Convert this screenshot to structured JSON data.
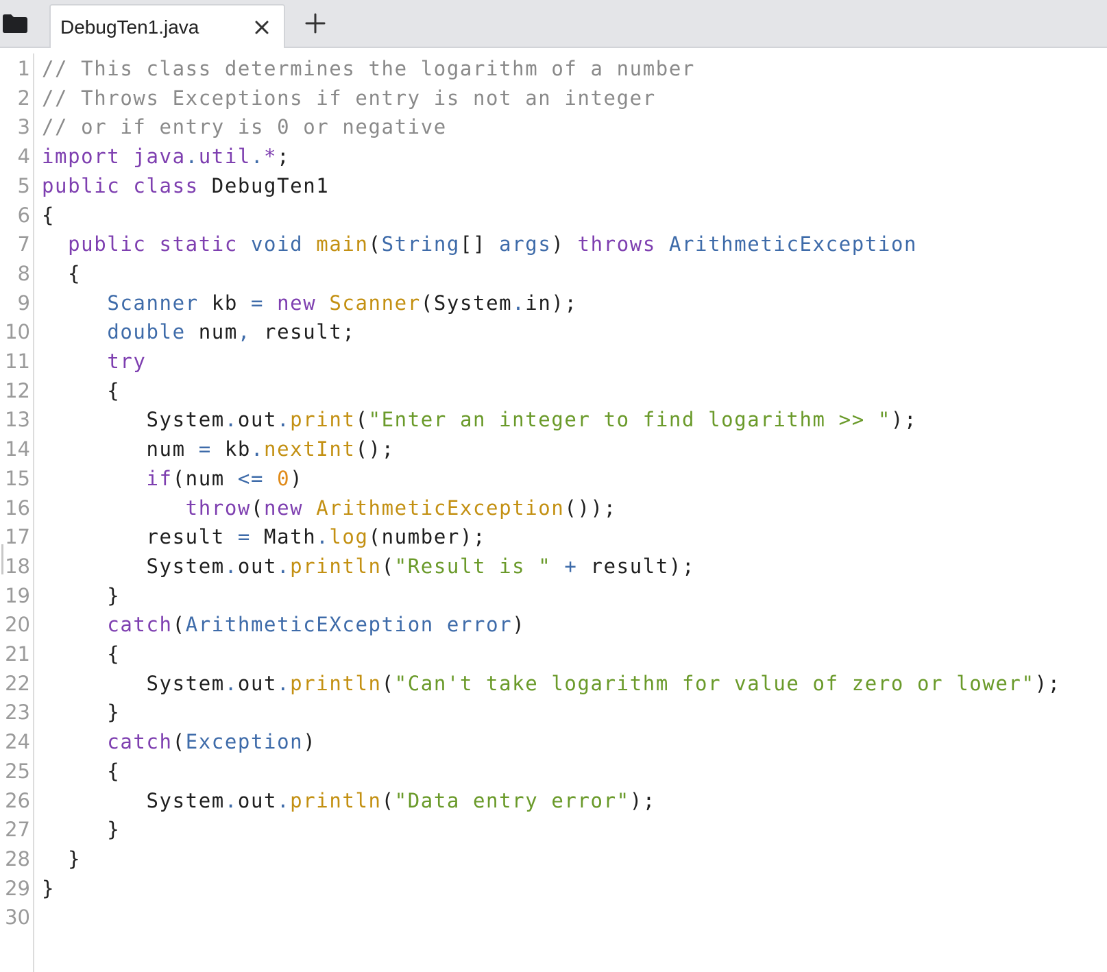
{
  "tab": {
    "title": "DebugTen1.java"
  },
  "icons": {
    "folder": "folder-icon",
    "close": "close-icon",
    "add": "plus-icon"
  },
  "colors": {
    "comment": "#8a8a8a",
    "keyword": "#7e3fb0",
    "type": "#3e6ba9",
    "method": "#c39012",
    "string": "#6a9a2a",
    "number": "#e08a18",
    "plain": "#1f1f1f",
    "line_number": "#9a9a9a",
    "tab_bar": "#e4e5e8"
  },
  "editor": {
    "lines": [
      {
        "num": "1",
        "tokens": [
          {
            "t": "// This class determines the logarithm of a number",
            "c": "comment"
          }
        ]
      },
      {
        "num": "2",
        "tokens": [
          {
            "t": "// Throws Exceptions if entry is not an integer",
            "c": "comment"
          }
        ]
      },
      {
        "num": "3",
        "tokens": [
          {
            "t": "// or if entry is 0 or negative",
            "c": "comment"
          }
        ]
      },
      {
        "num": "4",
        "tokens": [
          {
            "t": "import",
            "c": "keyword"
          },
          {
            "t": " ",
            "c": "plain"
          },
          {
            "t": "java",
            "c": "keyword"
          },
          {
            "t": ".",
            "c": "punct"
          },
          {
            "t": "util",
            "c": "keyword"
          },
          {
            "t": ".",
            "c": "punct"
          },
          {
            "t": "*",
            "c": "keyword"
          },
          {
            "t": ";",
            "c": "plain"
          }
        ]
      },
      {
        "num": "5",
        "tokens": [
          {
            "t": "public",
            "c": "keyword"
          },
          {
            "t": " ",
            "c": "plain"
          },
          {
            "t": "class",
            "c": "keyword"
          },
          {
            "t": " DebugTen1",
            "c": "plain"
          }
        ]
      },
      {
        "num": "6",
        "tokens": [
          {
            "t": "{",
            "c": "plain"
          }
        ]
      },
      {
        "num": "7",
        "tokens": [
          {
            "t": "  ",
            "c": "plain"
          },
          {
            "t": "public",
            "c": "keyword"
          },
          {
            "t": " ",
            "c": "plain"
          },
          {
            "t": "static",
            "c": "keyword"
          },
          {
            "t": " ",
            "c": "plain"
          },
          {
            "t": "void",
            "c": "type"
          },
          {
            "t": " ",
            "c": "plain"
          },
          {
            "t": "main",
            "c": "method"
          },
          {
            "t": "(",
            "c": "plain"
          },
          {
            "t": "String",
            "c": "type"
          },
          {
            "t": "[] ",
            "c": "plain"
          },
          {
            "t": "args",
            "c": "type"
          },
          {
            "t": ") ",
            "c": "plain"
          },
          {
            "t": "throws",
            "c": "keyword"
          },
          {
            "t": " ",
            "c": "plain"
          },
          {
            "t": "ArithmeticException",
            "c": "type"
          }
        ]
      },
      {
        "num": "8",
        "tokens": [
          {
            "t": "  {",
            "c": "plain"
          }
        ]
      },
      {
        "num": "9",
        "tokens": [
          {
            "t": "     ",
            "c": "plain"
          },
          {
            "t": "Scanner",
            "c": "type"
          },
          {
            "t": " kb ",
            "c": "plain"
          },
          {
            "t": "=",
            "c": "punct"
          },
          {
            "t": " ",
            "c": "plain"
          },
          {
            "t": "new",
            "c": "keyword"
          },
          {
            "t": " ",
            "c": "plain"
          },
          {
            "t": "Scanner",
            "c": "method"
          },
          {
            "t": "(System",
            "c": "plain"
          },
          {
            "t": ".",
            "c": "punct"
          },
          {
            "t": "in);",
            "c": "plain"
          }
        ]
      },
      {
        "num": "10",
        "tokens": [
          {
            "t": "     ",
            "c": "plain"
          },
          {
            "t": "double",
            "c": "type"
          },
          {
            "t": " num",
            "c": "plain"
          },
          {
            "t": ",",
            "c": "punct"
          },
          {
            "t": " result;",
            "c": "plain"
          }
        ]
      },
      {
        "num": "11",
        "tokens": [
          {
            "t": "     ",
            "c": "plain"
          },
          {
            "t": "try",
            "c": "keyword"
          }
        ]
      },
      {
        "num": "12",
        "tokens": [
          {
            "t": "     {",
            "c": "plain"
          }
        ]
      },
      {
        "num": "13",
        "tokens": [
          {
            "t": "        System",
            "c": "plain"
          },
          {
            "t": ".",
            "c": "punct"
          },
          {
            "t": "out",
            "c": "plain"
          },
          {
            "t": ".",
            "c": "punct"
          },
          {
            "t": "print",
            "c": "method"
          },
          {
            "t": "(",
            "c": "plain"
          },
          {
            "t": "\"Enter an integer to find logarithm >> \"",
            "c": "string"
          },
          {
            "t": ");",
            "c": "plain"
          }
        ]
      },
      {
        "num": "14",
        "tokens": [
          {
            "t": "        num ",
            "c": "plain"
          },
          {
            "t": "=",
            "c": "punct"
          },
          {
            "t": " kb",
            "c": "plain"
          },
          {
            "t": ".",
            "c": "punct"
          },
          {
            "t": "nextInt",
            "c": "method"
          },
          {
            "t": "();",
            "c": "plain"
          }
        ]
      },
      {
        "num": "15",
        "tokens": [
          {
            "t": "        ",
            "c": "plain"
          },
          {
            "t": "if",
            "c": "keyword"
          },
          {
            "t": "(num ",
            "c": "plain"
          },
          {
            "t": "<=",
            "c": "punct"
          },
          {
            "t": " ",
            "c": "plain"
          },
          {
            "t": "0",
            "c": "number"
          },
          {
            "t": ")",
            "c": "plain"
          }
        ]
      },
      {
        "num": "16",
        "tokens": [
          {
            "t": "           ",
            "c": "plain"
          },
          {
            "t": "throw",
            "c": "keyword"
          },
          {
            "t": "(",
            "c": "plain"
          },
          {
            "t": "new",
            "c": "keyword"
          },
          {
            "t": " ",
            "c": "plain"
          },
          {
            "t": "ArithmeticException",
            "c": "method"
          },
          {
            "t": "());",
            "c": "plain"
          }
        ]
      },
      {
        "num": "17",
        "tokens": [
          {
            "t": "        result ",
            "c": "plain"
          },
          {
            "t": "=",
            "c": "punct"
          },
          {
            "t": " Math",
            "c": "plain"
          },
          {
            "t": ".",
            "c": "punct"
          },
          {
            "t": "log",
            "c": "method"
          },
          {
            "t": "(number);",
            "c": "plain"
          }
        ]
      },
      {
        "num": "18",
        "tokens": [
          {
            "t": "        System",
            "c": "plain"
          },
          {
            "t": ".",
            "c": "punct"
          },
          {
            "t": "out",
            "c": "plain"
          },
          {
            "t": ".",
            "c": "punct"
          },
          {
            "t": "println",
            "c": "method"
          },
          {
            "t": "(",
            "c": "plain"
          },
          {
            "t": "\"Result is \"",
            "c": "string"
          },
          {
            "t": " ",
            "c": "plain"
          },
          {
            "t": "+",
            "c": "punct"
          },
          {
            "t": " result);",
            "c": "plain"
          }
        ]
      },
      {
        "num": "19",
        "tokens": [
          {
            "t": "     }",
            "c": "plain"
          }
        ]
      },
      {
        "num": "20",
        "tokens": [
          {
            "t": "     ",
            "c": "plain"
          },
          {
            "t": "catch",
            "c": "keyword"
          },
          {
            "t": "(",
            "c": "plain"
          },
          {
            "t": "ArithmeticEXception",
            "c": "type"
          },
          {
            "t": " ",
            "c": "plain"
          },
          {
            "t": "error",
            "c": "type"
          },
          {
            "t": ")",
            "c": "plain"
          }
        ]
      },
      {
        "num": "21",
        "tokens": [
          {
            "t": "     {",
            "c": "plain"
          }
        ]
      },
      {
        "num": "22",
        "tokens": [
          {
            "t": "        System",
            "c": "plain"
          },
          {
            "t": ".",
            "c": "punct"
          },
          {
            "t": "out",
            "c": "plain"
          },
          {
            "t": ".",
            "c": "punct"
          },
          {
            "t": "println",
            "c": "method"
          },
          {
            "t": "(",
            "c": "plain"
          },
          {
            "t": "\"Can't take logarithm for value of zero or lower\"",
            "c": "string"
          },
          {
            "t": ");",
            "c": "plain"
          }
        ]
      },
      {
        "num": "23",
        "tokens": [
          {
            "t": "     }",
            "c": "plain"
          }
        ]
      },
      {
        "num": "24",
        "tokens": [
          {
            "t": "     ",
            "c": "plain"
          },
          {
            "t": "catch",
            "c": "keyword"
          },
          {
            "t": "(",
            "c": "plain"
          },
          {
            "t": "Exception",
            "c": "type"
          },
          {
            "t": ")",
            "c": "plain"
          }
        ]
      },
      {
        "num": "25",
        "tokens": [
          {
            "t": "     {",
            "c": "plain"
          }
        ]
      },
      {
        "num": "26",
        "tokens": [
          {
            "t": "        System",
            "c": "plain"
          },
          {
            "t": ".",
            "c": "punct"
          },
          {
            "t": "out",
            "c": "plain"
          },
          {
            "t": ".",
            "c": "punct"
          },
          {
            "t": "println",
            "c": "method"
          },
          {
            "t": "(",
            "c": "plain"
          },
          {
            "t": "\"Data entry error\"",
            "c": "string"
          },
          {
            "t": ");",
            "c": "plain"
          }
        ]
      },
      {
        "num": "27",
        "tokens": [
          {
            "t": "     }",
            "c": "plain"
          }
        ]
      },
      {
        "num": "28",
        "tokens": [
          {
            "t": "  }",
            "c": "plain"
          }
        ]
      },
      {
        "num": "29",
        "tokens": [
          {
            "t": "}",
            "c": "plain"
          }
        ]
      },
      {
        "num": "30",
        "tokens": []
      }
    ]
  }
}
